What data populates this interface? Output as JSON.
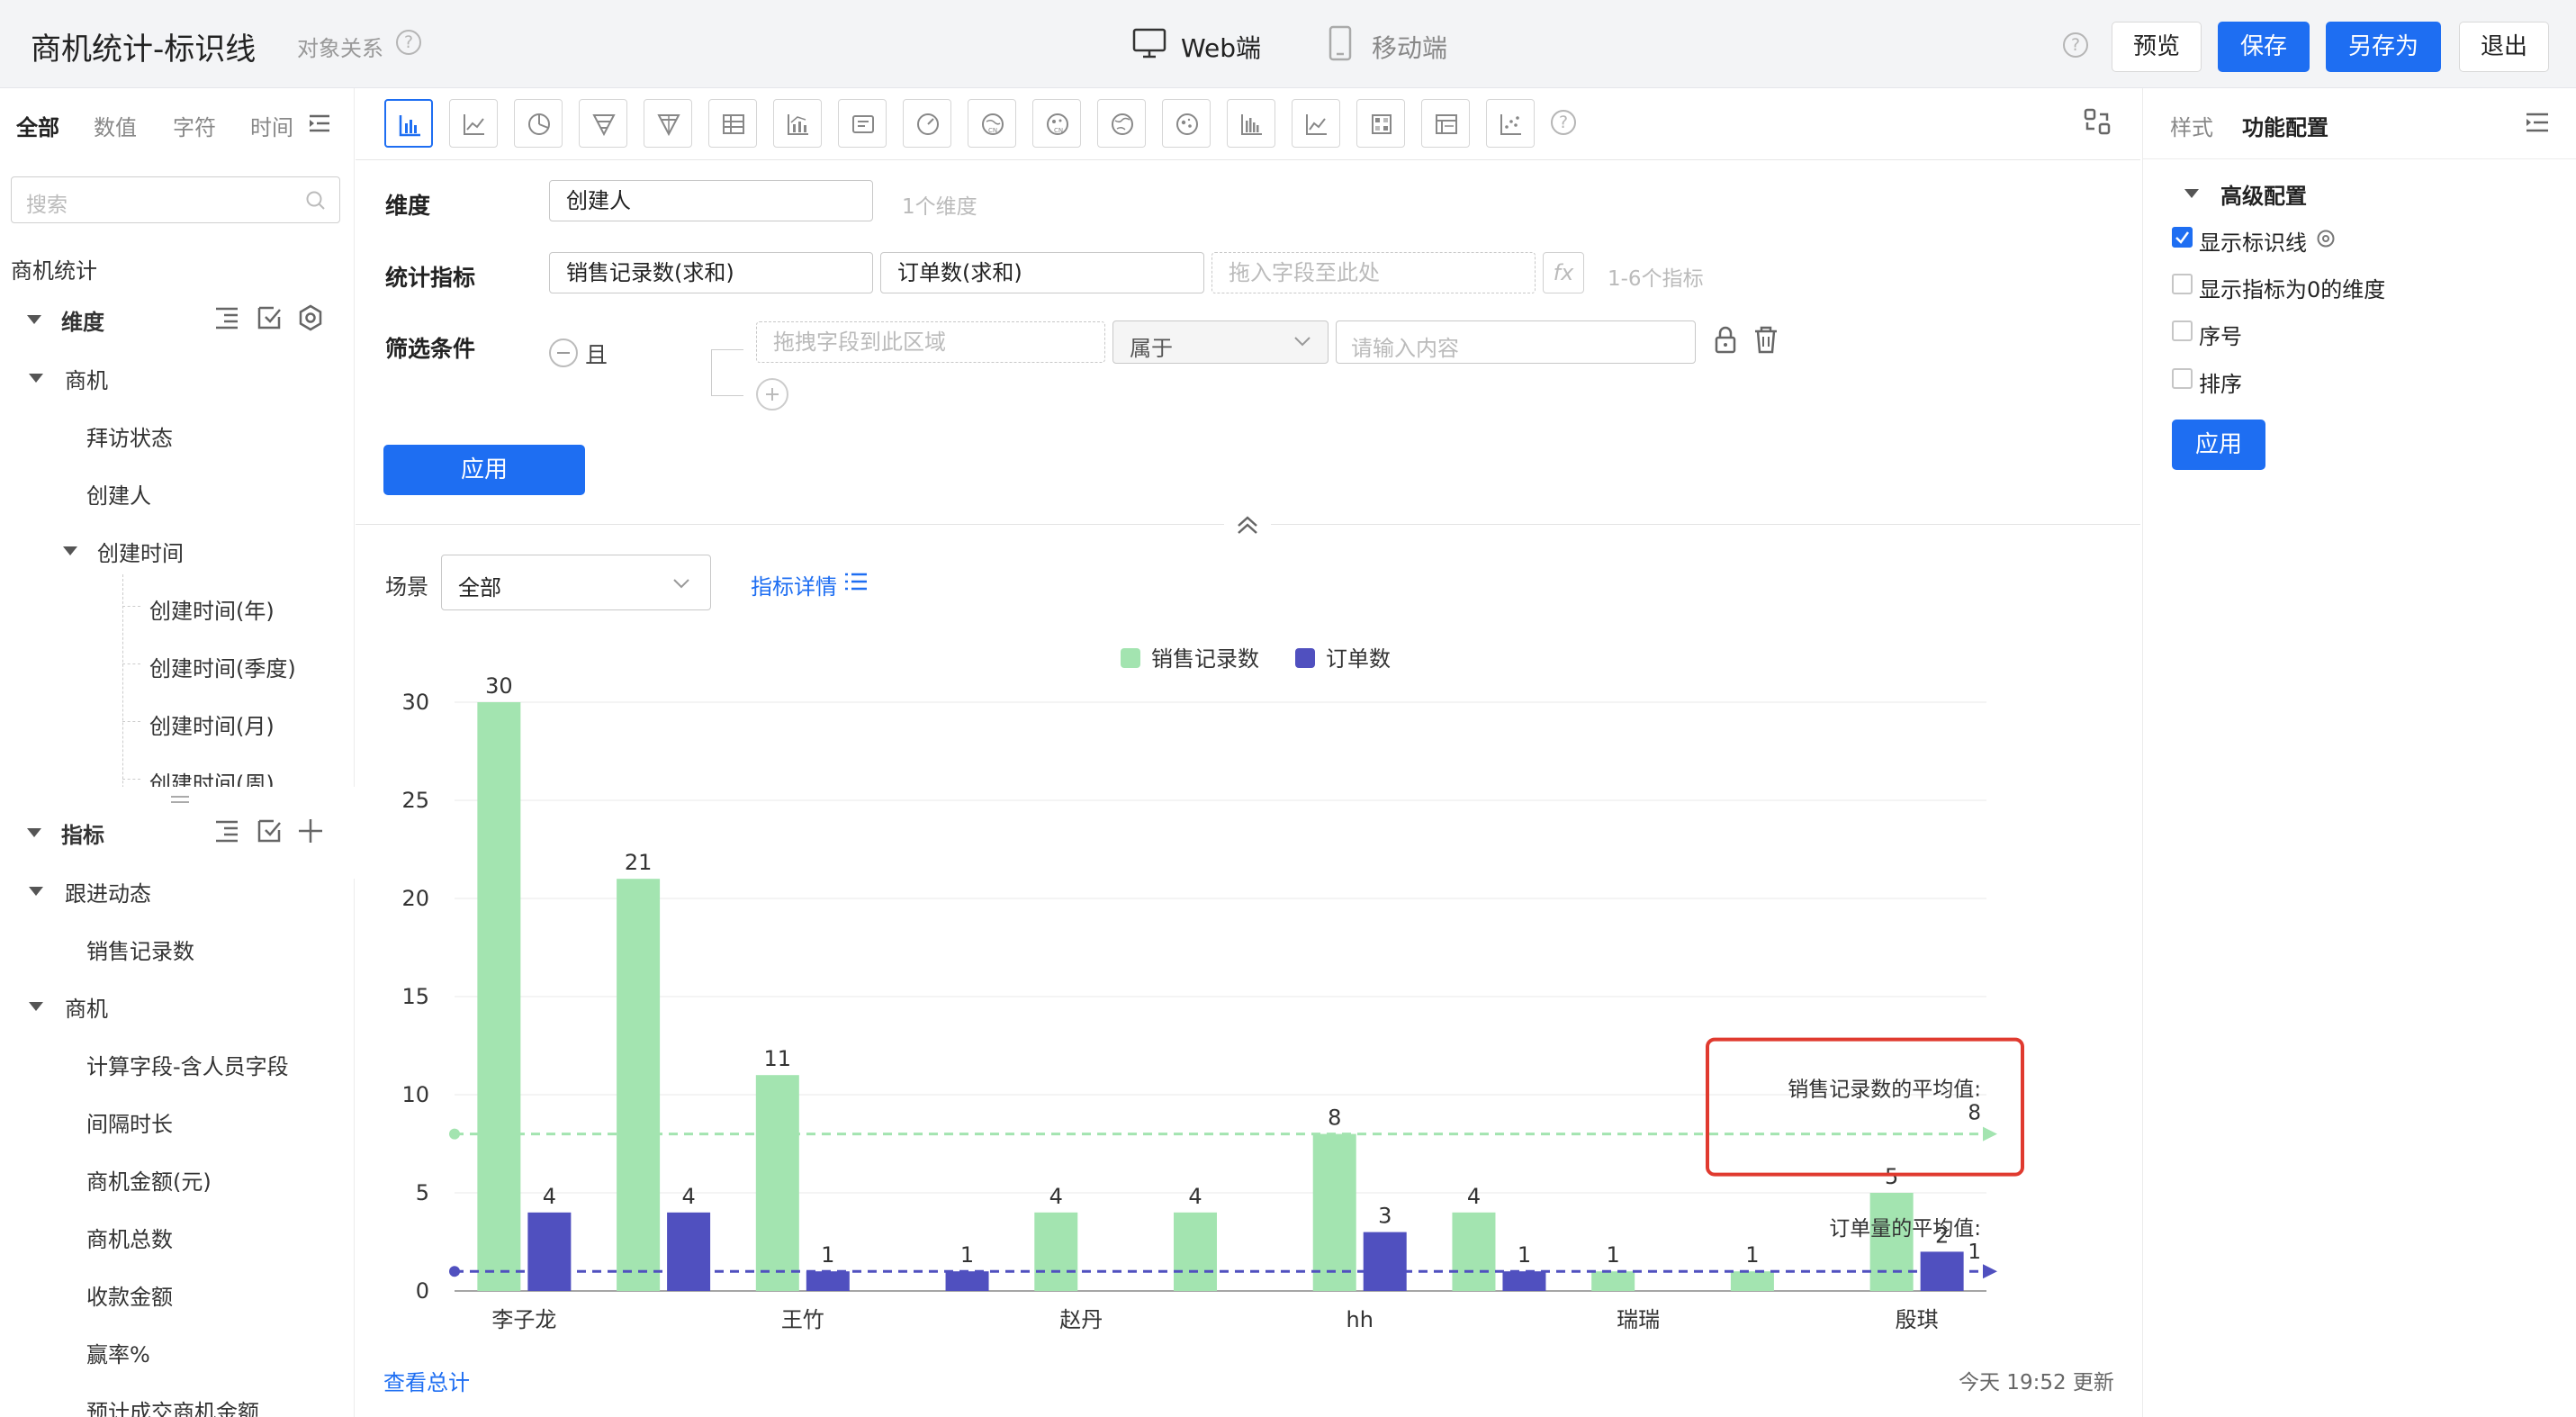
{
  "header": {
    "title": "商机统计-标识线",
    "relation": "对象关系",
    "platform_web": "Web端",
    "platform_mobile": "移动端",
    "preview": "预览",
    "save": "保存",
    "save_as": "另存为",
    "exit": "退出"
  },
  "left": {
    "tabs": [
      "全部",
      "数值",
      "字符",
      "时间"
    ],
    "search_placeholder": "搜索",
    "dataset": "商机统计",
    "dimension_header": "维度",
    "dim_group": "商机",
    "dim_items": [
      "拜访状态",
      "创建人"
    ],
    "time_group": "创建时间",
    "time_items": [
      "创建时间(年)",
      "创建时间(季度)",
      "创建时间(月)",
      "创建时间(周)"
    ],
    "metric_header": "指标",
    "metric_group1": "跟进动态",
    "metric_group1_items": [
      "销售记录数"
    ],
    "metric_group2": "商机",
    "metric_group2_items": [
      "计算字段-含人员字段",
      "间隔时长",
      "商机金额(元)",
      "商机总数",
      "收款金额",
      "赢率%",
      "预计成交商机金额"
    ]
  },
  "config": {
    "dimension_label": "维度",
    "dimension_value": "创建人",
    "dimension_hint": "1个维度",
    "metric_label": "统计指标",
    "metric_values": [
      "销售记录数(求和)",
      "订单数(求和)"
    ],
    "metric_drop": "拖入字段至此处",
    "metric_hint": "1-6个指标",
    "fx": "fx",
    "filter_label": "筛选条件",
    "filter_logic": "且",
    "filter_field": "拖拽字段到此区域",
    "filter_op": "属于",
    "filter_value": "请输入内容",
    "apply": "应用"
  },
  "scene": {
    "label": "场景",
    "value": "全部",
    "detail": "指标详情"
  },
  "footer": {
    "view_total": "查看总计",
    "updated": "今天 19:52 更新"
  },
  "right": {
    "tabs": [
      "样式",
      "功能配置"
    ],
    "section": "高级配置",
    "options": [
      {
        "label": "显示标识线",
        "checked": true
      },
      {
        "label": "显示指标为0的维度",
        "checked": false
      },
      {
        "label": "序号",
        "checked": false
      },
      {
        "label": "排序",
        "checked": false
      }
    ],
    "apply": "应用"
  },
  "colors": {
    "accent": "#1e6ef2",
    "series1": "#a3e4b0",
    "series2": "#5050bf",
    "highlight": "#e03a2f"
  },
  "chart_data": {
    "type": "bar",
    "categories": [
      "李子龙",
      "",
      "王竹",
      "",
      "赵丹",
      "",
      "hh",
      "",
      "瑞瑞",
      "",
      "殷琪"
    ],
    "series": [
      {
        "name": "销售记录数",
        "values": [
          30,
          21,
          11,
          null,
          4,
          4,
          8,
          4,
          1,
          1,
          5
        ]
      },
      {
        "name": "订单数",
        "values": [
          4,
          4,
          1,
          1,
          null,
          null,
          3,
          1,
          null,
          null,
          2
        ]
      }
    ],
    "ylim": [
      0,
      30
    ],
    "yticks": [
      0,
      5,
      10,
      15,
      20,
      25,
      30
    ],
    "grid": true,
    "legend": "top-center",
    "reference_lines": [
      {
        "series": "销售记录数",
        "label": "销售记录数的平均值:",
        "value": 8
      },
      {
        "series": "订单数",
        "label": "订单量的平均值:",
        "value": 1
      }
    ]
  }
}
